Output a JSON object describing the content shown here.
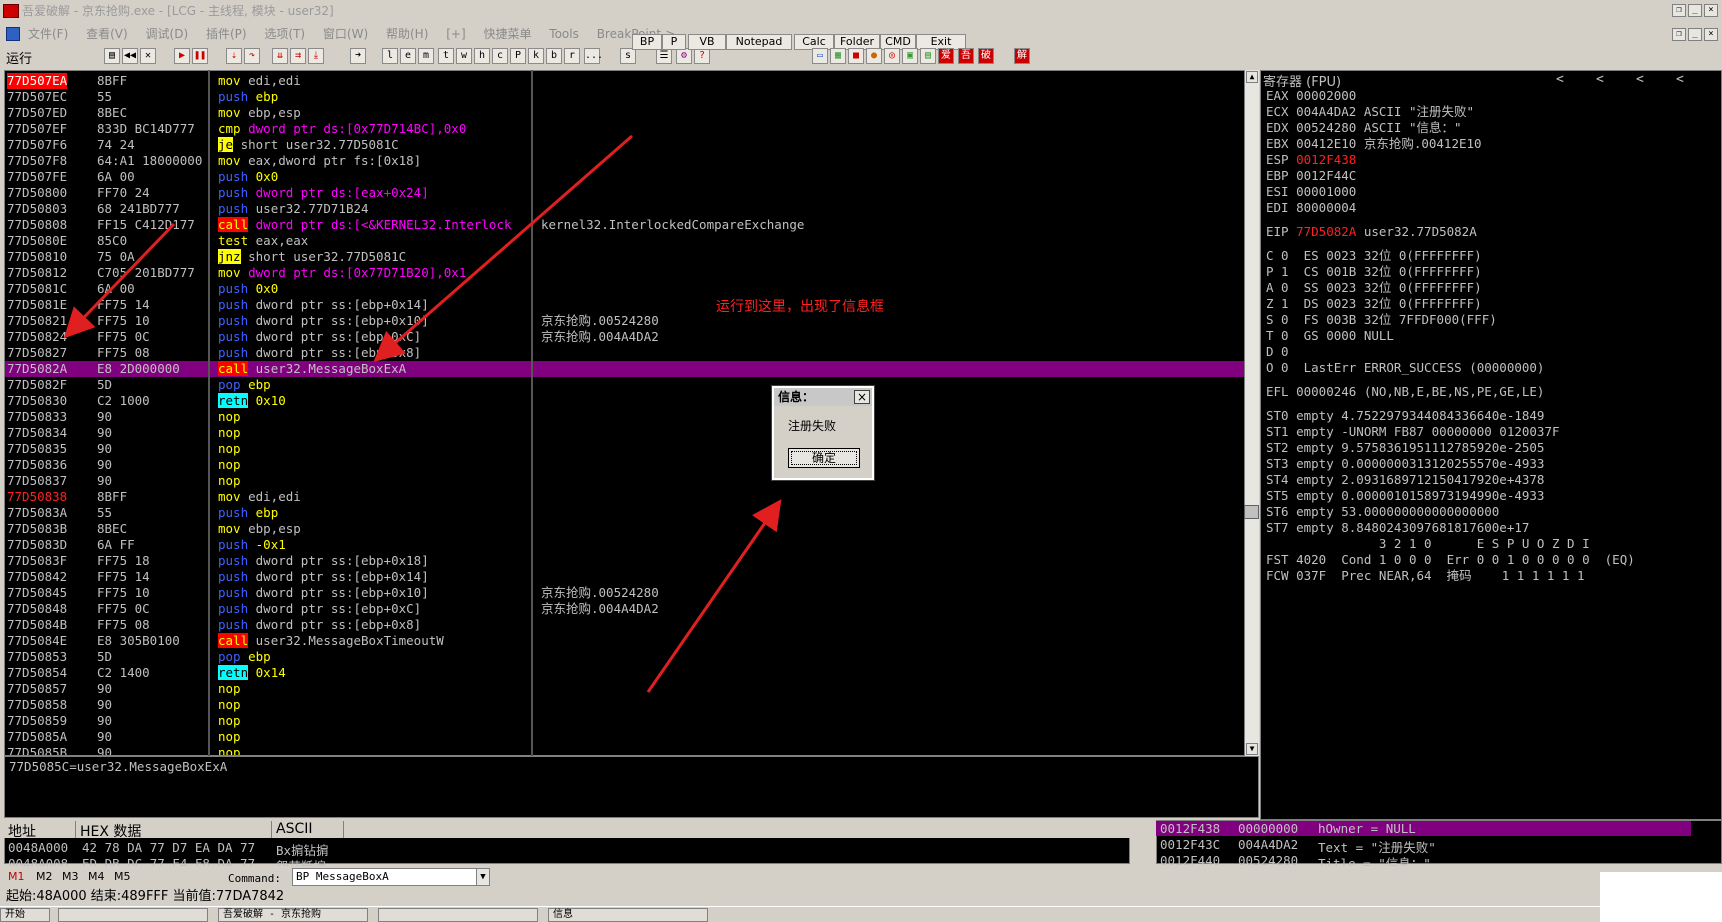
{
  "window": {
    "title": "吾爱破解 - 京东抢购.exe - [LCG - 主线程, 模块 - user32]"
  },
  "menubar": [
    "文件(F)",
    "查看(V)",
    "调试(D)",
    "插件(P)",
    "选项(T)",
    "窗口(W)",
    "帮助(H)",
    "[+]",
    "快捷菜单",
    "Tools",
    "BreakPoint->"
  ],
  "toolbar": {
    "status": "运行",
    "letters": [
      "l",
      "e",
      "m",
      "t",
      "w",
      "h",
      "c",
      "P",
      "k",
      "b",
      "r",
      "...",
      "s"
    ],
    "tool_buttons": [
      "BP",
      "P",
      "VB",
      "Notepad",
      "Calc",
      "Folder",
      "CMD",
      "Exit"
    ],
    "right_icons": [
      "爱",
      "破",
      "解"
    ]
  },
  "disasm": {
    "rows": [
      {
        "addr": "77D507EA",
        "hex": "8BFF",
        "mn": "mov",
        "ops": "edi,edi",
        "eip_mark": true
      },
      {
        "addr": "77D507EC",
        "hex": "55",
        "mn": "push",
        "ops": "ebp"
      },
      {
        "addr": "77D507ED",
        "hex": "8BEC",
        "mn": "mov",
        "ops": "ebp,esp"
      },
      {
        "addr": "77D507EF",
        "hex": "833D BC14D777",
        "mn": "cmp",
        "ops": "dword ptr ds:[0x77D714BC],0x0"
      },
      {
        "addr": "77D507F6",
        "hex": "74 24",
        "mn": "je",
        "ops": "short user32.77D5081C"
      },
      {
        "addr": "77D507F8",
        "hex": "64:A1 18000000",
        "mn": "mov",
        "ops": "eax,dword ptr fs:[0x18]"
      },
      {
        "addr": "77D507FE",
        "hex": "6A 00",
        "mn": "push",
        "ops": "0x0"
      },
      {
        "addr": "77D50800",
        "hex": "FF70 24",
        "mn": "push",
        "ops": "dword ptr ds:[eax+0x24]"
      },
      {
        "addr": "77D50803",
        "hex": "68 241BD777",
        "mn": "push",
        "ops": "user32.77D71B24"
      },
      {
        "addr": "77D50808",
        "hex": "FF15 C412D177",
        "mn": "call",
        "ops": "dword ptr ds:[<&KERNEL32.Interlock",
        "comment": "kernel32.InterlockedCompareExchange"
      },
      {
        "addr": "77D5080E",
        "hex": "85C0",
        "mn": "test",
        "ops": "eax,eax"
      },
      {
        "addr": "77D50810",
        "hex": "75 0A",
        "mn": "jnz",
        "ops": "short user32.77D5081C"
      },
      {
        "addr": "77D50812",
        "hex": "C705 201BD777",
        "mn": "mov",
        "ops": "dword ptr ds:[0x77D71B20],0x1"
      },
      {
        "addr": "77D5081C",
        "hex": "6A 00",
        "mn": "push",
        "ops": "0x0"
      },
      {
        "addr": "77D5081E",
        "hex": "FF75 14",
        "mn": "push",
        "ops": "dword ptr ss:[ebp+0x14]"
      },
      {
        "addr": "77D50821",
        "hex": "FF75 10",
        "mn": "push",
        "ops": "dword ptr ss:[ebp+0x10]",
        "comment": "京东抢购.00524280"
      },
      {
        "addr": "77D50824",
        "hex": "FF75 0C",
        "mn": "push",
        "ops": "dword ptr ss:[ebp+0xC]",
        "comment": "京东抢购.004A4DA2"
      },
      {
        "addr": "77D50827",
        "hex": "FF75 08",
        "mn": "push",
        "ops": "dword ptr ss:[ebp+0x8]"
      },
      {
        "addr": "77D5082A",
        "hex": "E8 2D000000",
        "mn": "call",
        "ops": "user32.MessageBoxExA",
        "selected": true
      },
      {
        "addr": "77D5082F",
        "hex": "5D",
        "mn": "pop",
        "ops": "ebp"
      },
      {
        "addr": "77D50830",
        "hex": "C2 1000",
        "mn": "retn",
        "ops": "0x10"
      },
      {
        "addr": "77D50833",
        "hex": "90",
        "mn": "nop",
        "ops": ""
      },
      {
        "addr": "77D50834",
        "hex": "90",
        "mn": "nop",
        "ops": ""
      },
      {
        "addr": "77D50835",
        "hex": "90",
        "mn": "nop",
        "ops": ""
      },
      {
        "addr": "77D50836",
        "hex": "90",
        "mn": "nop",
        "ops": ""
      },
      {
        "addr": "77D50837",
        "hex": "90",
        "mn": "nop",
        "ops": ""
      },
      {
        "addr": "77D50838",
        "hex": "8BFF",
        "mn": "mov",
        "ops": "edi,edi",
        "red": true
      },
      {
        "addr": "77D5083A",
        "hex": "55",
        "mn": "push",
        "ops": "ebp"
      },
      {
        "addr": "77D5083B",
        "hex": "8BEC",
        "mn": "mov",
        "ops": "ebp,esp"
      },
      {
        "addr": "77D5083D",
        "hex": "6A FF",
        "mn": "push",
        "ops": "-0x1"
      },
      {
        "addr": "77D5083F",
        "hex": "FF75 18",
        "mn": "push",
        "ops": "dword ptr ss:[ebp+0x18]"
      },
      {
        "addr": "77D50842",
        "hex": "FF75 14",
        "mn": "push",
        "ops": "dword ptr ss:[ebp+0x14]"
      },
      {
        "addr": "77D50845",
        "hex": "FF75 10",
        "mn": "push",
        "ops": "dword ptr ss:[ebp+0x10]",
        "comment": "京东抢购.00524280"
      },
      {
        "addr": "77D50848",
        "hex": "FF75 0C",
        "mn": "push",
        "ops": "dword ptr ss:[ebp+0xC]",
        "comment": "京东抢购.004A4DA2"
      },
      {
        "addr": "77D5084B",
        "hex": "FF75 08",
        "mn": "push",
        "ops": "dword ptr ss:[ebp+0x8]"
      },
      {
        "addr": "77D5084E",
        "hex": "E8 305B0100",
        "mn": "call",
        "ops": "user32.MessageBoxTimeoutW"
      },
      {
        "addr": "77D50853",
        "hex": "5D",
        "mn": "pop",
        "ops": "ebp"
      },
      {
        "addr": "77D50854",
        "hex": "C2 1400",
        "mn": "retn",
        "ops": "0x14"
      },
      {
        "addr": "77D50857",
        "hex": "90",
        "mn": "nop",
        "ops": ""
      },
      {
        "addr": "77D50858",
        "hex": "90",
        "mn": "nop",
        "ops": ""
      },
      {
        "addr": "77D50859",
        "hex": "90",
        "mn": "nop",
        "ops": ""
      },
      {
        "addr": "77D5085A",
        "hex": "90",
        "mn": "nop",
        "ops": ""
      },
      {
        "addr": "77D5085B",
        "hex": "90",
        "mn": "nop",
        "ops": ""
      }
    ]
  },
  "info_line": "77D5085C=user32.MessageBoxExA",
  "annotation": "运行到这里，出现了信息框",
  "dialog": {
    "title": "信息：",
    "message": "注册失败",
    "ok": "确定",
    "close": "×"
  },
  "registers": {
    "title": "寄存器 (FPU)",
    "arrows": [
      "<",
      "<",
      "<",
      "<"
    ],
    "lines": [
      {
        "t": "EAX 00002000"
      },
      {
        "t": "ECX 004A4DA2 ASCII \"注册失败\""
      },
      {
        "t": "EDX 00524280 ASCII \"信息：\""
      },
      {
        "t": "EBX 00412E10 京东抢购.00412E10"
      },
      {
        "t": "ESP ",
        "r": "0012F438"
      },
      {
        "t": "EBP 0012F44C"
      },
      {
        "t": "ESI 00001000"
      },
      {
        "t": "EDI 80000004"
      },
      {
        "t": ""
      },
      {
        "t": "EIP ",
        "r": "77D5082A",
        "s": " user32.77D5082A"
      },
      {
        "t": ""
      },
      {
        "t": "C 0  ES 0023 32位 0(FFFFFFFF)"
      },
      {
        "t": "P 1  CS 001B 32位 0(FFFFFFFF)"
      },
      {
        "t": "A 0  SS 0023 32位 0(FFFFFFFF)"
      },
      {
        "t": "Z 1  DS 0023 32位 0(FFFFFFFF)"
      },
      {
        "t": "S 0  FS 003B 32位 7FFDF000(FFF)"
      },
      {
        "t": "T 0  GS 0000 NULL"
      },
      {
        "t": "D 0"
      },
      {
        "t": "O 0  LastErr ERROR_SUCCESS (00000000)"
      },
      {
        "t": ""
      },
      {
        "t": "EFL 00000246 (NO,NB,E,BE,NS,PE,GE,LE)"
      },
      {
        "t": ""
      },
      {
        "t": "ST0 empty 4.7522979344084336640e-1849"
      },
      {
        "t": "ST1 empty -UNORM FB87 00000000 0120037F"
      },
      {
        "t": "ST2 empty 9.5758361951112785920e-2505"
      },
      {
        "t": "ST3 empty 0.0000000313120255570e-4933"
      },
      {
        "t": "ST4 empty 2.0931689712150417920e+4378"
      },
      {
        "t": "ST5 empty 0.0000010158973194990e-4933"
      },
      {
        "t": "ST6 empty 53.000000000000000000"
      },
      {
        "t": "ST7 empty 8.8480243097681817600e+17"
      },
      {
        "t": "               3 2 1 0      E S P U O Z D I"
      },
      {
        "t": "FST 4020  Cond 1 0 0 0  Err 0 0 1 0 0 0 0 0  (EQ)"
      },
      {
        "t": "FCW 037F  Prec NEAR,64  掩码    1 1 1 1 1 1"
      }
    ]
  },
  "dump": {
    "headers": [
      "地址",
      "HEX 数据",
      "ASCII"
    ],
    "rows": [
      {
        "addr": "0048A000",
        "hex": "42 78 DA 77 D7 EA DA 77",
        "ascii": "Bx掮钻掮"
      },
      {
        "addr": "0048A008",
        "hex": "ED DB DC 77 F4 F8 DA 77",
        "ascii": "眢苁羝掮"
      }
    ]
  },
  "stack": {
    "rows": [
      {
        "addr": "0012F438",
        "val": "00000000",
        "cmt": "hOwner = NULL"
      },
      {
        "addr": "0012F43C",
        "val": "004A4DA2",
        "cmt": "Text = \"注册失败\""
      },
      {
        "addr": "0012F440",
        "val": "00524280",
        "cmt": "Title = \"信息：\""
      }
    ]
  },
  "cmdbar": {
    "tabs": [
      "M1",
      "M2",
      "M3",
      "M4",
      "M5"
    ],
    "label": "Command:",
    "value": "BP  MessageBoxA"
  },
  "statusbar": "起始:48A000 结束:489FFF 当前值:77DA7842",
  "taskbar": [
    "开始",
    "",
    "吾爱破解 - 京东抢购",
    "",
    "信息"
  ]
}
